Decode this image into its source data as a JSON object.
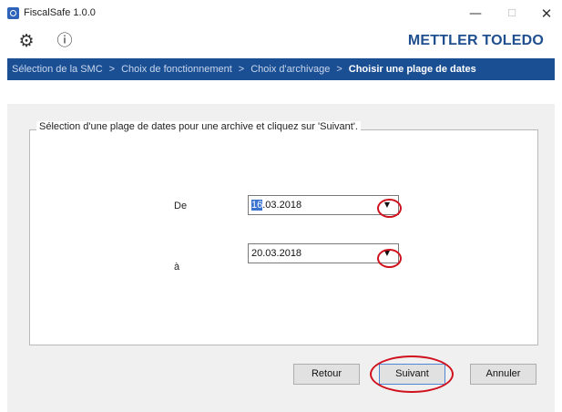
{
  "window": {
    "title": "FiscalSafe 1.0.0",
    "minimize_glyph": "—",
    "maximize_glyph": "☐",
    "close_glyph": "✕"
  },
  "toolbar": {
    "settings_icon": "gear-icon",
    "settings_glyph": "⚙",
    "info_icon": "info-icon",
    "info_glyph": "ⓘ",
    "brand": "METTLER TOLEDO"
  },
  "breadcrumb": {
    "items": [
      "Sélection de la SMC",
      "Choix de fonctionnement",
      "Choix d'archivage",
      "Choisir une plage de dates"
    ],
    "separator": ">"
  },
  "form": {
    "legend": "Sélection d'une plage de dates pour une archive et cliquez sur 'Suivant'.",
    "from_label": "De",
    "from_day": "16",
    "from_rest": ".03.2018",
    "to_label": "à",
    "to_value": "20.03.2018",
    "dropdown_glyph": "▼"
  },
  "buttons": {
    "back": "Retour",
    "next": "Suivant",
    "cancel": "Annuler"
  },
  "colors": {
    "breadcrumb_bg": "#1b4f93",
    "brand": "#1f4f8f",
    "highlight_circle": "#d0101c"
  }
}
